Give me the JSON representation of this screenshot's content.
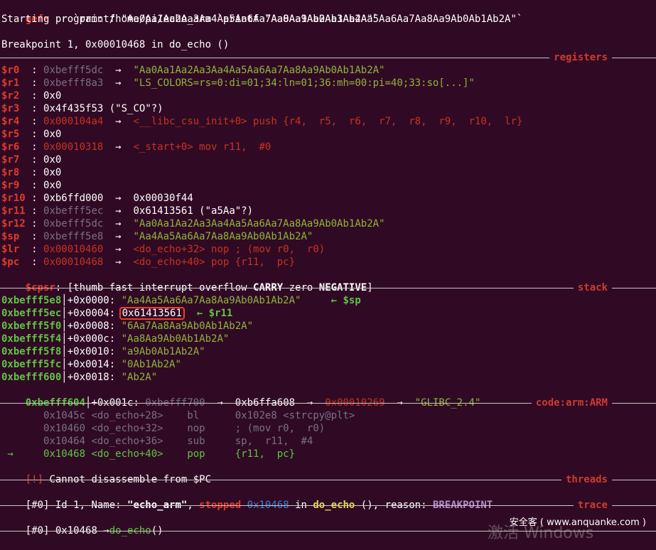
{
  "prompt": {
    "gef": "gef",
    "arrow": "➤",
    "command": "  r `printf \"Aa0Aa1Aa2Aa3Aa4Aa5Aa6Aa7Aa8Aa9Ab0Ab1Ab2A\"`"
  },
  "starting": "Starting program: /home/pi/echo_arm `printf \"Aa0Aa1Aa2Aa3Aa4Aa5Aa6Aa7Aa8Aa9Ab0Ab1Ab2A\"`",
  "breakpoint": "Breakpoint 1, 0x00010468 in do_echo ()",
  "sections": {
    "registers": "registers",
    "stack": "stack",
    "code": "code:arm:ARM",
    "threads": "threads",
    "trace": "trace"
  },
  "registers": [
    {
      "name": "$r0 ",
      "sep": " : ",
      "addr": "0xbefff5dc",
      "arrow": "  →  ",
      "val": "\"Aa0Aa1Aa2Aa3Aa4Aa5Aa6Aa7Aa8Aa9Ab0Ab1Ab2A\"",
      "vclass": "ygreen",
      "aclass": "gray"
    },
    {
      "name": "$r1 ",
      "sep": " : ",
      "addr": "0xbefff8a3",
      "arrow": "  →  ",
      "val": "\"LS_COLORS=rs=0:di=01;34:ln=01;36:mh=00:pi=40;33:so[...]\"",
      "vclass": "ygreen",
      "aclass": "gray"
    },
    {
      "name": "$r2 ",
      "sep": " : ",
      "addr": "0x0",
      "arrow": "",
      "val": "",
      "vclass": "white",
      "aclass": "white"
    },
    {
      "name": "$r3 ",
      "sep": " : ",
      "addr": "0x4f435f53",
      "arrow": " ",
      "val": "(\"S_CO\"?)",
      "vclass": "white",
      "aclass": "white"
    },
    {
      "name": "$r4 ",
      "sep": " : ",
      "addr": "0x000104a4",
      "arrow": "  →  ",
      "val": "<__libc_csu_init+0> push {r4,  r5,  r6,  r7,  r8,  r9,  r10,  lr}",
      "vclass": "dred",
      "aclass": "dred"
    },
    {
      "name": "$r5 ",
      "sep": " : ",
      "addr": "0x0",
      "arrow": "",
      "val": "",
      "vclass": "white",
      "aclass": "white"
    },
    {
      "name": "$r6 ",
      "sep": " : ",
      "addr": "0x00010318",
      "arrow": "  →  ",
      "val": "<_start+0> mov r11,  #0",
      "vclass": "dred",
      "aclass": "dred"
    },
    {
      "name": "$r7 ",
      "sep": " : ",
      "addr": "0x0",
      "arrow": "",
      "val": "",
      "vclass": "white",
      "aclass": "white"
    },
    {
      "name": "$r8 ",
      "sep": " : ",
      "addr": "0x0",
      "arrow": "",
      "val": "",
      "vclass": "white",
      "aclass": "white"
    },
    {
      "name": "$r9 ",
      "sep": " : ",
      "addr": "0x0",
      "arrow": "",
      "val": "",
      "vclass": "white",
      "aclass": "white"
    },
    {
      "name": "$r10",
      "sep": " : ",
      "addr": "0xb6ffd000",
      "arrow": "  →  ",
      "val": "0x00030f44",
      "vclass": "white",
      "aclass": "white"
    },
    {
      "name": "$r11",
      "sep": " : ",
      "addr": "0xbefff5ec",
      "arrow": "  →  ",
      "val": "0x61413561 (\"a5Aa\"?)",
      "vclass": "white",
      "aclass": "gray"
    },
    {
      "name": "$r12",
      "sep": " : ",
      "addr": "0xbefff5dc",
      "arrow": "  →  ",
      "val": "\"Aa0Aa1Aa2Aa3Aa4Aa5Aa6Aa7Aa8Aa9Ab0Ab1Ab2A\"",
      "vclass": "ygreen",
      "aclass": "gray"
    },
    {
      "name": "$sp ",
      "sep": " : ",
      "addr": "0xbefff5e8",
      "arrow": "  →  ",
      "val": "\"Aa4Aa5Aa6Aa7Aa8Aa9Ab0Ab1Ab2A\"",
      "vclass": "ygreen",
      "aclass": "gray"
    },
    {
      "name": "$lr ",
      "sep": " : ",
      "addr": "0x00010460",
      "arrow": "  →  ",
      "val": "<do_echo+32> nop ; (mov r0,  r0)",
      "vclass": "dred",
      "aclass": "dred"
    },
    {
      "name": "$pc ",
      "sep": " : ",
      "addr": "0x00010468",
      "arrow": "  →  ",
      "val": "<do_echo+40> pop {r11,  pc}",
      "vclass": "dred",
      "aclass": "dred"
    }
  ],
  "cpsr": {
    "name": "$cpsr",
    "sep": ": ",
    "pre": "[thumb fast interrupt overflow ",
    "carry": "CARRY",
    "mid": " zero ",
    "negative": "NEGATIVE",
    "post": "]"
  },
  "stack": [
    {
      "addr": "0xbefff5e8",
      "off": "+0x0000: ",
      "val": "\"Aa4Aa5Aa6Aa7Aa8Aa9Ab0Ab1Ab2A\"",
      "note": "     ← $sp"
    },
    {
      "addr": "0xbefff5ec",
      "off": "+0x0004: ",
      "val": "0x61413561",
      "note": "  ← $r11"
    },
    {
      "addr": "0xbefff5f0",
      "off": "+0x0008: ",
      "val": "\"6Aa7Aa8Aa9Ab0Ab1Ab2A\"",
      "note": ""
    },
    {
      "addr": "0xbefff5f4",
      "off": "+0x000c: ",
      "val": "\"Aa8Aa9Ab0Ab1Ab2A\"",
      "note": ""
    },
    {
      "addr": "0xbefff5f8",
      "off": "+0x0010: ",
      "val": "\"a9Ab0Ab1Ab2A\"",
      "note": ""
    },
    {
      "addr": "0xbefff5fc",
      "off": "+0x0014: ",
      "val": "\"0Ab1Ab2A\"",
      "note": ""
    },
    {
      "addr": "0xbefff600",
      "off": "+0x0018: ",
      "val": "\"Ab2A\"",
      "note": ""
    }
  ],
  "stack_last": {
    "addr": "0xbefff604",
    "off": "+0x001c: ",
    "p1": "0xbefff700",
    "a1": "  →  ",
    "p2": "0xb6ffa608",
    "a2": "  →  ",
    "p3": "0x00010269",
    "a3": "  →  ",
    "p4": "\"GLIBC_2.4\""
  },
  "code": [
    {
      "prefix": "   ",
      "addr": "0x1045c",
      "sym": "<do_echo+28>",
      "op": "bl",
      "args": "0x102e8 <strcpy@plt>"
    },
    {
      "prefix": "   ",
      "addr": "0x10460",
      "sym": "<do_echo+32>",
      "op": "nop",
      "args": "; (mov r0,  r0)"
    },
    {
      "prefix": "   ",
      "addr": "0x10464",
      "sym": "<do_echo+36>",
      "op": "sub",
      "args": "sp,  r11,  #4"
    },
    {
      "prefix": " → ",
      "addr": "0x10468",
      "sym": "<do_echo+40>",
      "op": "pop",
      "args": "{r11,  pc}"
    }
  ],
  "code_error": {
    "tag": "[!]",
    "msg": " Cannot disassemble from $PC"
  },
  "thread": {
    "id": "[#0]",
    "t1": " Id 1, Name: ",
    "name": "\"echo_arm\"",
    "t2": ", ",
    "stopped": "stopped",
    "t3": " ",
    "addr": "0x10468",
    "t4": " in ",
    "func": "do_echo",
    "t5": " (), reason: ",
    "reason": "BREAKPOINT"
  },
  "trace": {
    "id": "[#0]",
    "addr": " 0x10468 →",
    "func": "do_echo",
    "post": "()"
  },
  "watermark": "安全客 ( www.anquanke.com )",
  "watermark_bg": "激活 Windows"
}
